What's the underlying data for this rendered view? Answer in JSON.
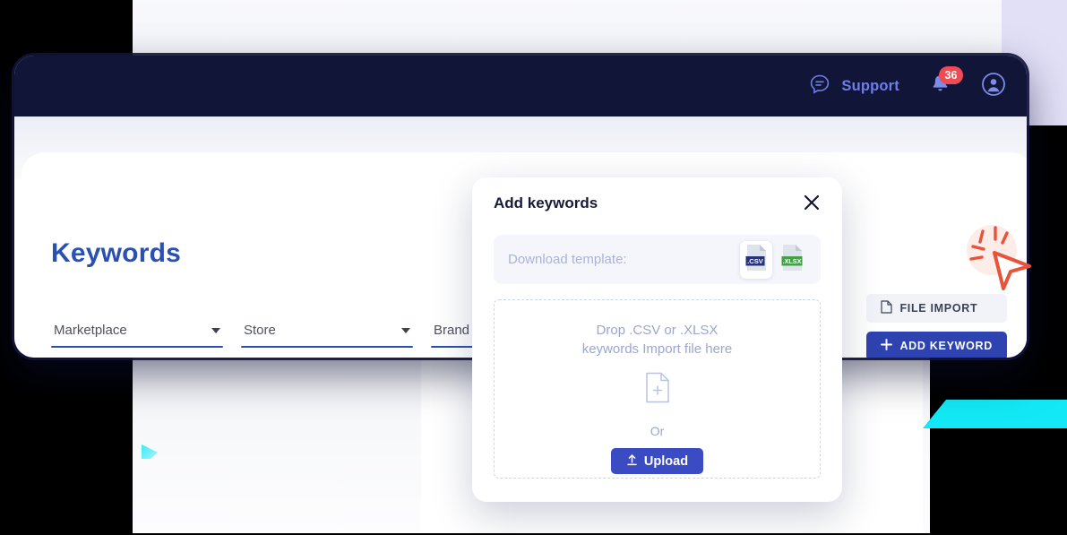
{
  "navbar": {
    "support": {
      "label": "Support",
      "icon": "chat-bubble-icon"
    },
    "notifications": {
      "count": "36",
      "icon": "bell-icon"
    },
    "account": {
      "icon": "user-avatar-icon"
    }
  },
  "page": {
    "title": "Keywords"
  },
  "filters": [
    {
      "label": "Marketplace",
      "caret": "chevron-down-icon"
    },
    {
      "label": "Store",
      "caret": "chevron-down-icon"
    },
    {
      "label": "Brand",
      "caret": "chevron-down-icon"
    }
  ],
  "actions": {
    "file_import": {
      "label": "FILE IMPORT",
      "icon": "document-icon"
    },
    "add_keyword": {
      "label": "ADD KEYWORD",
      "icon": "plus-icon"
    }
  },
  "modal": {
    "title": "Add keywords",
    "close_icon": "close-icon",
    "template": {
      "label": "Download template:",
      "csv_label": ".CSV",
      "xlsx_label": ".XLSX"
    },
    "dropzone": {
      "line1": "Drop .CSV or .XLSX",
      "line2": "keywords Import file here",
      "file_icon": "file-plus-icon",
      "or": "Or",
      "upload_label": "Upload",
      "upload_icon": "upload-icon"
    }
  },
  "colors": {
    "navbar_bg": "#111537",
    "brand_blue": "#2b50b4",
    "primary_button": "#2f43b0",
    "upload_button": "#3b4bc4",
    "badge_red": "#ef4b55",
    "csv_badge": "#26327c",
    "xlsx_badge": "#43a047",
    "cyan_accent": "#13e9f6",
    "cursor_orange": "#e8533a"
  },
  "cursor": {
    "icon": "arrow-cursor-icon",
    "state": "clicking"
  }
}
